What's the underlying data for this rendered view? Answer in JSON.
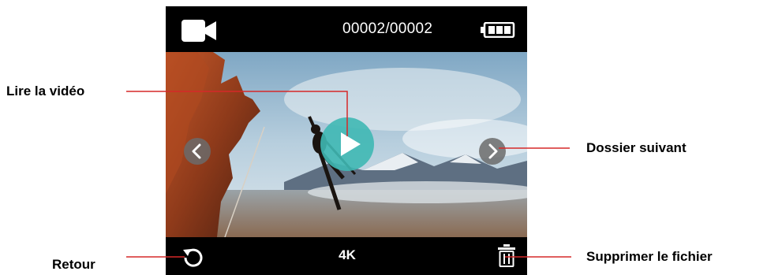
{
  "screen": {
    "file_counter": "00002/00002",
    "resolution": "4K",
    "icons": {
      "mode": "video-camera-icon",
      "battery": "battery-full-icon",
      "play": "play-icon",
      "prev": "chevron-left-icon",
      "next": "chevron-right-icon",
      "back": "back-arrow-icon",
      "delete": "trash-icon"
    }
  },
  "callouts": {
    "play": "Lire la vidéo",
    "next_folder": "Dossier suivant",
    "back": "Retour",
    "delete": "Supprimer le fichier"
  },
  "colors": {
    "play_button": "#3fb8b4",
    "nav_button": "#6b6b6b",
    "callout_line": "#d62828"
  }
}
